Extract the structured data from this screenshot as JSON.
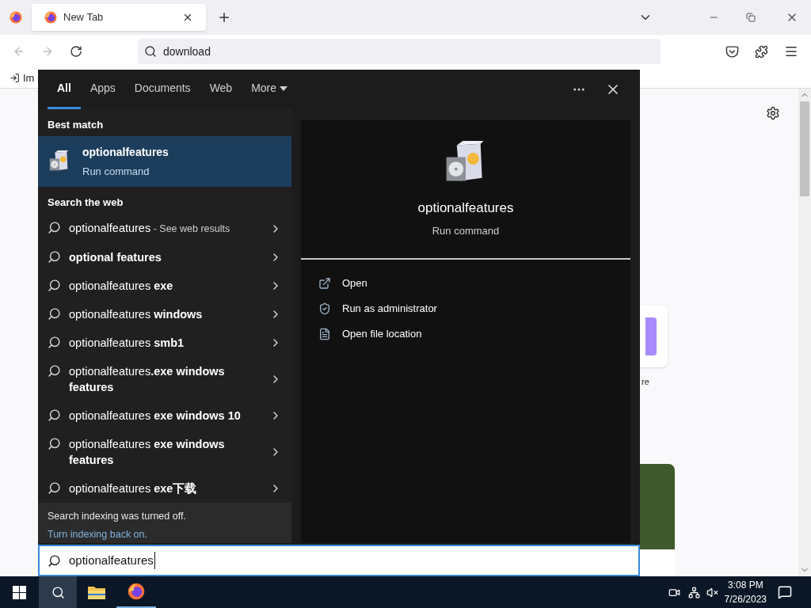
{
  "browser": {
    "tabs": [
      {
        "title": "New Tab",
        "selected": true
      }
    ],
    "address": "download",
    "bookmark": "Im"
  },
  "page": {
    "tile_label": "re"
  },
  "search": {
    "tabs": [
      {
        "label": "All",
        "selected": true
      },
      {
        "label": "Apps",
        "selected": false
      },
      {
        "label": "Documents",
        "selected": false
      },
      {
        "label": "Web",
        "selected": false
      },
      {
        "label": "More",
        "selected": false,
        "dropdown": true
      }
    ],
    "best_match_heading": "Best match",
    "best_match": {
      "title": "optionalfeatures",
      "subtitle": "Run command",
      "selected": true
    },
    "web_heading": "Search the web",
    "web_results": [
      {
        "plain": "optionalfeatures",
        "note": "- See web results"
      },
      {
        "bold": "optional features"
      },
      {
        "plain": "optionalfeatures",
        "bold": "exe"
      },
      {
        "plain": "optionalfeatures",
        "bold": "windows"
      },
      {
        "plain": "optionalfeatures",
        "bold": "smb1"
      },
      {
        "plain": "optionalfeatures",
        "bold": ".exe windows features"
      },
      {
        "plain": "optionalfeatures",
        "bold": "exe windows 10"
      },
      {
        "plain": "optionalfeatures",
        "bold": "exe windows features"
      },
      {
        "plain": "optionalfeatures",
        "bold": "exe下载"
      }
    ],
    "notice": "Search indexing was turned off.",
    "notice_link": "Turn indexing back on.",
    "preview": {
      "title": "optionalfeatures",
      "subtitle": "Run command",
      "actions": [
        {
          "kind": "open",
          "label": "Open"
        },
        {
          "kind": "admin",
          "label": "Run as administrator"
        },
        {
          "kind": "folder",
          "label": "Open file location"
        }
      ]
    },
    "query": "optionalfeatures"
  },
  "taskbar": {
    "time": "3:08 PM",
    "date": "7/26/2023"
  }
}
